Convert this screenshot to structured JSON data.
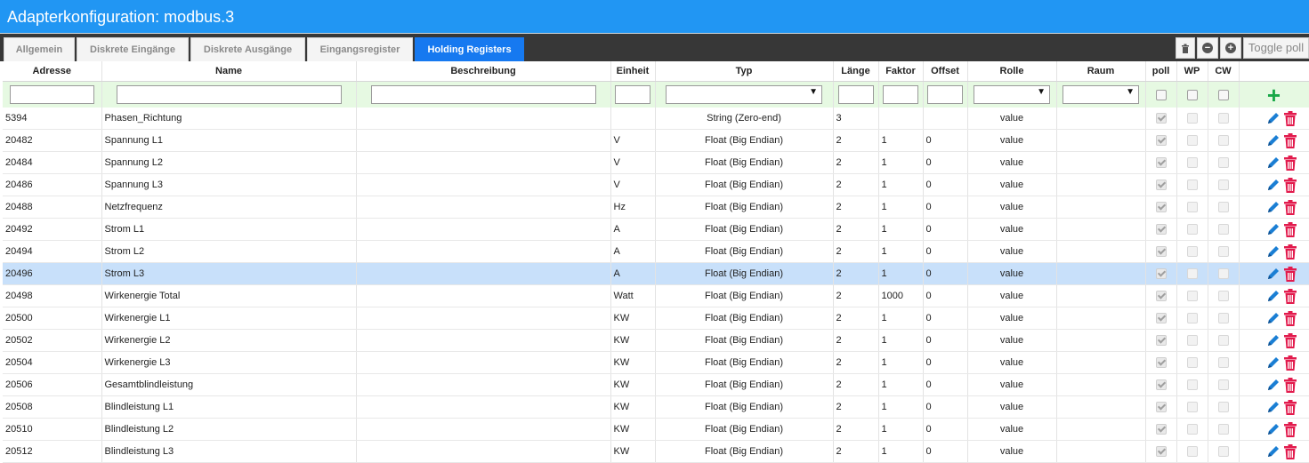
{
  "window": {
    "title": "Adapterkonfiguration: modbus.3"
  },
  "tabs": [
    {
      "label": "Allgemein",
      "active": false
    },
    {
      "label": "Diskrete Eingänge",
      "active": false
    },
    {
      "label": "Diskrete Ausgänge",
      "active": false
    },
    {
      "label": "Eingangsregister",
      "active": false
    },
    {
      "label": "Holding Registers",
      "active": true
    }
  ],
  "toolbar": {
    "toggle_label": "Toggle poll",
    "icons": [
      "trash-icon",
      "minus-circle-icon",
      "plus-circle-icon"
    ]
  },
  "columns": [
    "Adresse",
    "Name",
    "Beschreibung",
    "Einheit",
    "Typ",
    "Länge",
    "Faktor",
    "Offset",
    "Rolle",
    "Raum",
    "poll",
    "WP",
    "CW"
  ],
  "rows": [
    {
      "address": "5394",
      "name": "Phasen_Richtung",
      "description": "",
      "unit": "",
      "type": "String (Zero-end)",
      "length": "3",
      "factor": "",
      "offset": "",
      "role": "value",
      "room": "",
      "poll": true,
      "wp": false,
      "cw": false,
      "selected": false
    },
    {
      "address": "20482",
      "name": "Spannung L1",
      "description": "",
      "unit": "V",
      "type": "Float (Big Endian)",
      "length": "2",
      "factor": "1",
      "offset": "0",
      "role": "value",
      "room": "",
      "poll": true,
      "wp": false,
      "cw": false,
      "selected": false
    },
    {
      "address": "20484",
      "name": "Spannung L2",
      "description": "",
      "unit": "V",
      "type": "Float (Big Endian)",
      "length": "2",
      "factor": "1",
      "offset": "0",
      "role": "value",
      "room": "",
      "poll": true,
      "wp": false,
      "cw": false,
      "selected": false
    },
    {
      "address": "20486",
      "name": "Spannung L3",
      "description": "",
      "unit": "V",
      "type": "Float (Big Endian)",
      "length": "2",
      "factor": "1",
      "offset": "0",
      "role": "value",
      "room": "",
      "poll": true,
      "wp": false,
      "cw": false,
      "selected": false
    },
    {
      "address": "20488",
      "name": "Netzfrequenz",
      "description": "",
      "unit": "Hz",
      "type": "Float (Big Endian)",
      "length": "2",
      "factor": "1",
      "offset": "0",
      "role": "value",
      "room": "",
      "poll": true,
      "wp": false,
      "cw": false,
      "selected": false
    },
    {
      "address": "20492",
      "name": "Strom L1",
      "description": "",
      "unit": "A",
      "type": "Float (Big Endian)",
      "length": "2",
      "factor": "1",
      "offset": "0",
      "role": "value",
      "room": "",
      "poll": true,
      "wp": false,
      "cw": false,
      "selected": false
    },
    {
      "address": "20494",
      "name": "Strom L2",
      "description": "",
      "unit": "A",
      "type": "Float (Big Endian)",
      "length": "2",
      "factor": "1",
      "offset": "0",
      "role": "value",
      "room": "",
      "poll": true,
      "wp": false,
      "cw": false,
      "selected": false
    },
    {
      "address": "20496",
      "name": "Strom L3",
      "description": "",
      "unit": "A",
      "type": "Float (Big Endian)",
      "length": "2",
      "factor": "1",
      "offset": "0",
      "role": "value",
      "room": "",
      "poll": true,
      "wp": false,
      "cw": false,
      "selected": true
    },
    {
      "address": "20498",
      "name": "Wirkenergie Total",
      "description": "",
      "unit": "Watt",
      "type": "Float (Big Endian)",
      "length": "2",
      "factor": "1000",
      "offset": "0",
      "role": "value",
      "room": "",
      "poll": true,
      "wp": false,
      "cw": false,
      "selected": false
    },
    {
      "address": "20500",
      "name": "Wirkenergie L1",
      "description": "",
      "unit": "KW",
      "type": "Float (Big Endian)",
      "length": "2",
      "factor": "1",
      "offset": "0",
      "role": "value",
      "room": "",
      "poll": true,
      "wp": false,
      "cw": false,
      "selected": false
    },
    {
      "address": "20502",
      "name": "Wirkenergie L2",
      "description": "",
      "unit": "KW",
      "type": "Float (Big Endian)",
      "length": "2",
      "factor": "1",
      "offset": "0",
      "role": "value",
      "room": "",
      "poll": true,
      "wp": false,
      "cw": false,
      "selected": false
    },
    {
      "address": "20504",
      "name": "Wirkenergie L3",
      "description": "",
      "unit": "KW",
      "type": "Float (Big Endian)",
      "length": "2",
      "factor": "1",
      "offset": "0",
      "role": "value",
      "room": "",
      "poll": true,
      "wp": false,
      "cw": false,
      "selected": false
    },
    {
      "address": "20506",
      "name": "Gesamtblindleistung",
      "description": "",
      "unit": "KW",
      "type": "Float (Big Endian)",
      "length": "2",
      "factor": "1",
      "offset": "0",
      "role": "value",
      "room": "",
      "poll": true,
      "wp": false,
      "cw": false,
      "selected": false
    },
    {
      "address": "20508",
      "name": "Blindleistung L1",
      "description": "",
      "unit": "KW",
      "type": "Float (Big Endian)",
      "length": "2",
      "factor": "1",
      "offset": "0",
      "role": "value",
      "room": "",
      "poll": true,
      "wp": false,
      "cw": false,
      "selected": false
    },
    {
      "address": "20510",
      "name": "Blindleistung L2",
      "description": "",
      "unit": "KW",
      "type": "Float (Big Endian)",
      "length": "2",
      "factor": "1",
      "offset": "0",
      "role": "value",
      "room": "",
      "poll": true,
      "wp": false,
      "cw": false,
      "selected": false
    },
    {
      "address": "20512",
      "name": "Blindleistung L3",
      "description": "",
      "unit": "KW",
      "type": "Float (Big Endian)",
      "length": "2",
      "factor": "1",
      "offset": "0",
      "role": "value",
      "room": "",
      "poll": true,
      "wp": false,
      "cw": false,
      "selected": false
    }
  ],
  "colors": {
    "title_bar": "#2196f3",
    "active_tab": "#1679f0",
    "filter_row": "#e6f9e2",
    "selected_row": "#c8e0fa",
    "edit_icon": "#1b7fd4",
    "delete_icon": "#e21b4d",
    "add_icon": "#18a847"
  }
}
